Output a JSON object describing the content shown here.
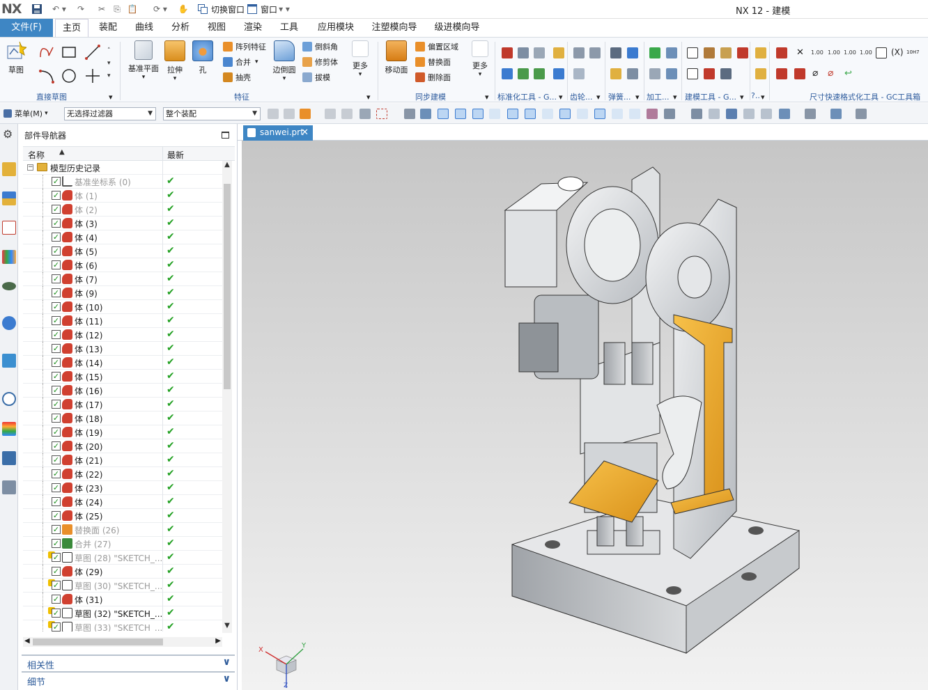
{
  "app": {
    "logo": "NX",
    "window_title": "NX 12 - 建模",
    "quick_access": {
      "switch_window_label": "切换窗口",
      "window_label": "窗口"
    }
  },
  "tabs": [
    {
      "label": "文件(F)"
    },
    {
      "label": "主页"
    },
    {
      "label": "装配"
    },
    {
      "label": "曲线"
    },
    {
      "label": "分析"
    },
    {
      "label": "视图"
    },
    {
      "label": "渲染"
    },
    {
      "label": "工具"
    },
    {
      "label": "应用模块"
    },
    {
      "label": "注塑模向导"
    },
    {
      "label": "级进模向导"
    }
  ],
  "ribbon": {
    "sketch_label": "草图",
    "groups": {
      "direct_sketch": "直接草图",
      "feature": "特征",
      "sync_modeling": "同步建模",
      "std_tools": "标准化工具 - G...",
      "gear": "齿轮...",
      "spring": "弹簧...",
      "machining": "加工...",
      "build_tools": "建模工具 - G...",
      "more_dots": "?..",
      "dim_format": "尺寸快速格式化工具 - GC工具箱"
    },
    "feature_buttons": {
      "datum_plane": "基准平面",
      "extrude": "拉伸",
      "hole": "孔",
      "pattern_feature": "阵列特征",
      "unite": "合并",
      "shell": "抽壳",
      "edge_blend": "边倒圆",
      "chamfer": "倒斜角",
      "trim_body": "修剪体",
      "draft": "拔模",
      "more": "更多"
    },
    "sync_buttons": {
      "move_face": "移动面",
      "offset_region": "偏置区域",
      "replace_face": "替换面",
      "delete_face": "删除面",
      "more": "更多"
    },
    "dim_tool_labels": [
      "1.00",
      "1.00",
      "1.00",
      "1.00",
      "10H7"
    ]
  },
  "selection_bar": {
    "menu_label": "菜单(M)",
    "filter_value": "无选择过滤器",
    "scope_value": "整个装配"
  },
  "navigator": {
    "title": "部件导航器",
    "col_name": "名称",
    "col_latest": "最新",
    "root_label": "模型历史记录",
    "rows": [
      {
        "label": "基准坐标系 (0)",
        "dim": true,
        "kind": "csys"
      },
      {
        "label": "体 (1)",
        "dim": true,
        "kind": "body"
      },
      {
        "label": "体 (2)",
        "dim": true,
        "kind": "body"
      },
      {
        "label": "体 (3)",
        "dim": false,
        "kind": "body"
      },
      {
        "label": "体 (4)",
        "dim": false,
        "kind": "body"
      },
      {
        "label": "体 (5)",
        "dim": false,
        "kind": "body"
      },
      {
        "label": "体 (6)",
        "dim": false,
        "kind": "body"
      },
      {
        "label": "体 (7)",
        "dim": false,
        "kind": "body"
      },
      {
        "label": "体 (9)",
        "dim": false,
        "kind": "body"
      },
      {
        "label": "体 (10)",
        "dim": false,
        "kind": "body"
      },
      {
        "label": "体 (11)",
        "dim": false,
        "kind": "body"
      },
      {
        "label": "体 (12)",
        "dim": false,
        "kind": "body"
      },
      {
        "label": "体 (13)",
        "dim": false,
        "kind": "body"
      },
      {
        "label": "体 (14)",
        "dim": false,
        "kind": "body"
      },
      {
        "label": "体 (15)",
        "dim": false,
        "kind": "body"
      },
      {
        "label": "体 (16)",
        "dim": false,
        "kind": "body"
      },
      {
        "label": "体 (17)",
        "dim": false,
        "kind": "body"
      },
      {
        "label": "体 (18)",
        "dim": false,
        "kind": "body"
      },
      {
        "label": "体 (19)",
        "dim": false,
        "kind": "body"
      },
      {
        "label": "体 (20)",
        "dim": false,
        "kind": "body"
      },
      {
        "label": "体 (21)",
        "dim": false,
        "kind": "body"
      },
      {
        "label": "体 (22)",
        "dim": false,
        "kind": "body"
      },
      {
        "label": "体 (23)",
        "dim": false,
        "kind": "body"
      },
      {
        "label": "体 (24)",
        "dim": false,
        "kind": "body"
      },
      {
        "label": "体 (25)",
        "dim": false,
        "kind": "body"
      },
      {
        "label": "替换面 (26)",
        "dim": true,
        "kind": "replace"
      },
      {
        "label": "合并 (27)",
        "dim": true,
        "kind": "unite"
      },
      {
        "label": "草图 (28) \"SKETCH_...",
        "dim": true,
        "kind": "sketch"
      },
      {
        "label": "体 (29)",
        "dim": false,
        "kind": "body"
      },
      {
        "label": "草图 (30) \"SKETCH_...",
        "dim": true,
        "kind": "sketch"
      },
      {
        "label": "体 (31)",
        "dim": false,
        "kind": "body"
      },
      {
        "label": "草图 (32) \"SKETCH_...",
        "dim": false,
        "kind": "sketch"
      },
      {
        "label": "草图 (33) \"SKETCH_...",
        "dim": true,
        "kind": "sketch"
      }
    ],
    "sections": {
      "dependencies": "相关性",
      "details": "细节"
    }
  },
  "graphics": {
    "doc_tab": "sanwei.prt",
    "triad": {
      "x": "X",
      "y": "Y",
      "z": "Z"
    }
  },
  "colors": {
    "accent_blue": "#3e86c4",
    "check_green": "#22a022",
    "part_gray": "#c9ccd0",
    "part_orange": "#e39a1c",
    "part_yellow": "#f1b51e"
  }
}
